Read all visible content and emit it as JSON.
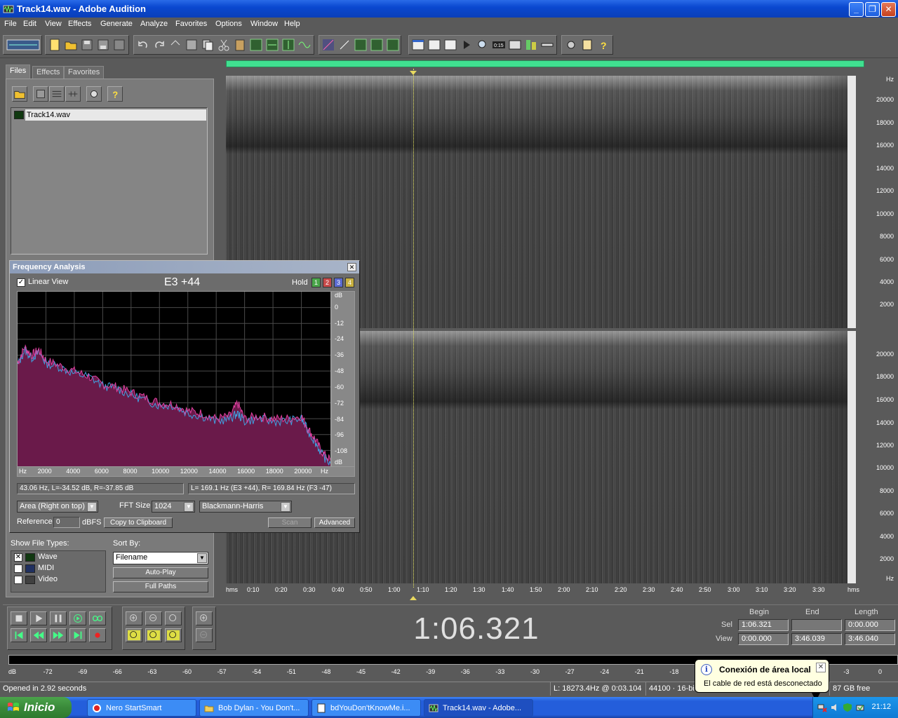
{
  "window": {
    "title": "Track14.wav - Adobe Audition"
  },
  "menu": [
    "File",
    "Edit",
    "View",
    "Effects",
    "Generate",
    "Analyze",
    "Favorites",
    "Options",
    "Window",
    "Help"
  ],
  "left_panel": {
    "tabs": [
      "Files",
      "Effects",
      "Favorites"
    ],
    "files": [
      "Track14.wav"
    ],
    "show_file_types_label": "Show File Types:",
    "file_types": [
      {
        "label": "Wave",
        "checked": true
      },
      {
        "label": "MIDI",
        "checked": false
      },
      {
        "label": "Video",
        "checked": false
      }
    ],
    "sort_by_label": "Sort By:",
    "sort_by_value": "Filename",
    "auto_play": "Auto-Play",
    "full_paths": "Full Paths"
  },
  "spectral": {
    "hz_unit": "Hz",
    "hz_ticks_top": [
      "20000",
      "18000",
      "16000",
      "14000",
      "12000",
      "10000",
      "8000",
      "6000",
      "4000",
      "2000"
    ],
    "hz_ticks_bottom": [
      "20000",
      "18000",
      "16000",
      "14000",
      "12000",
      "10000",
      "8000",
      "6000",
      "4000",
      "2000"
    ],
    "time_unit": "hms",
    "time_ticks": [
      "0:10",
      "0:20",
      "0:30",
      "0:40",
      "0:50",
      "1:00",
      "1:10",
      "1:20",
      "1:30",
      "1:40",
      "1:50",
      "2:00",
      "2:10",
      "2:20",
      "2:30",
      "2:40",
      "2:50",
      "3:00",
      "3:10",
      "3:20",
      "3:30"
    ]
  },
  "freq_analysis": {
    "title": "Frequency Analysis",
    "linear_view_label": "Linear View",
    "linear_view_checked": true,
    "note": "E3 +44",
    "hold_label": "Hold",
    "hold_buttons": [
      "1",
      "2",
      "3",
      "4"
    ],
    "hold_colors": [
      "#4aa64a",
      "#c84a4a",
      "#5a6ad0",
      "#c8b040"
    ],
    "db_ticks": [
      "dB",
      "0",
      "-12",
      "-24",
      "-36",
      "-48",
      "-60",
      "-72",
      "-84",
      "-96",
      "-108",
      "dB"
    ],
    "hz_ticks": [
      "Hz",
      "2000",
      "4000",
      "6000",
      "8000",
      "10000",
      "12000",
      "14000",
      "16000",
      "18000",
      "20000",
      "Hz"
    ],
    "readout_left": "43.06 Hz, L=-34.52 dB, R=-37.85 dB",
    "readout_right": "L=  169.1 Hz (E3 +44), R= 169.84 Hz (F3 -47)",
    "display_mode": "Area (Right on top)",
    "fft_size_label": "FFT Size",
    "fft_size": "1024",
    "window_function": "Blackmann-Harris",
    "reference_label": "Reference",
    "reference_value": "0",
    "dbfs_label": "dBFS",
    "copy_button": "Copy to Clipboard",
    "scan_button": "Scan",
    "advanced_button": "Advanced",
    "colors": {
      "left_fill": "#6a1a4a",
      "left_line": "#e040a0",
      "right_line": "#40a0e0"
    }
  },
  "chart_data": {
    "type": "area",
    "title": "",
    "xlabel": "Hz",
    "ylabel": "dB",
    "xlim": [
      0,
      22050
    ],
    "ylim": [
      -120,
      12
    ],
    "x": [
      0,
      500,
      1000,
      1500,
      2000,
      3000,
      4000,
      5000,
      6000,
      7000,
      8000,
      9000,
      10000,
      11000,
      12000,
      13000,
      14000,
      15000,
      15500,
      16000,
      17000,
      18000,
      19000,
      20000,
      20500,
      21000,
      21500,
      22050
    ],
    "series": [
      {
        "values": [
          -42,
          -30,
          -36,
          -32,
          -40,
          -44,
          -48,
          -52,
          -58,
          -60,
          -64,
          -68,
          -72,
          -73,
          -78,
          -80,
          -84,
          -82,
          -72,
          -84,
          -82,
          -84,
          -84,
          -82,
          -92,
          -100,
          -110,
          -115
        ]
      },
      {
        "values": [
          -44,
          -32,
          -38,
          -34,
          -42,
          -45,
          -50,
          -52,
          -59,
          -61,
          -66,
          -70,
          -74,
          -74,
          -80,
          -82,
          -86,
          -84,
          -80,
          -86,
          -84,
          -86,
          -86,
          -84,
          -94,
          -102,
          -112,
          -118
        ]
      }
    ]
  },
  "transport": {
    "time": "1:06.321",
    "begin_label": "Begin",
    "end_label": "End",
    "length_label": "Length",
    "sel_label": "Sel",
    "view_label": "View",
    "sel_begin": "1:06.321",
    "sel_end": "",
    "sel_length": "0:00.000",
    "view_begin": "0:00.000",
    "view_end": "3:46.039",
    "view_length": "3:46.040"
  },
  "meter": {
    "ticks": [
      "dB",
      "-72",
      "-69",
      "-66",
      "-63",
      "-60",
      "-57",
      "-54",
      "-51",
      "-48",
      "-45",
      "-42",
      "-39",
      "-36",
      "-33",
      "-30",
      "-27",
      "-24",
      "-21",
      "-18",
      "-15",
      "-12",
      "-9",
      "-6",
      "-3",
      "0"
    ]
  },
  "status": {
    "opened": "Opened in 2.92 seconds",
    "cursor": "L: 18273.4Hz @   0:03.104",
    "format": "44100 · 16-bit",
    "free": "87 GB free"
  },
  "balloon": {
    "title": "Conexión de área local",
    "text": "El cable de red está desconectado"
  },
  "taskbar": {
    "start": "Inicio",
    "tasks": [
      "Nero StartSmart",
      "Bob Dylan - You Don't...",
      "bdYouDon'tKnowMe.i...",
      "Track14.wav - Adobe..."
    ],
    "clock": "21:12"
  }
}
